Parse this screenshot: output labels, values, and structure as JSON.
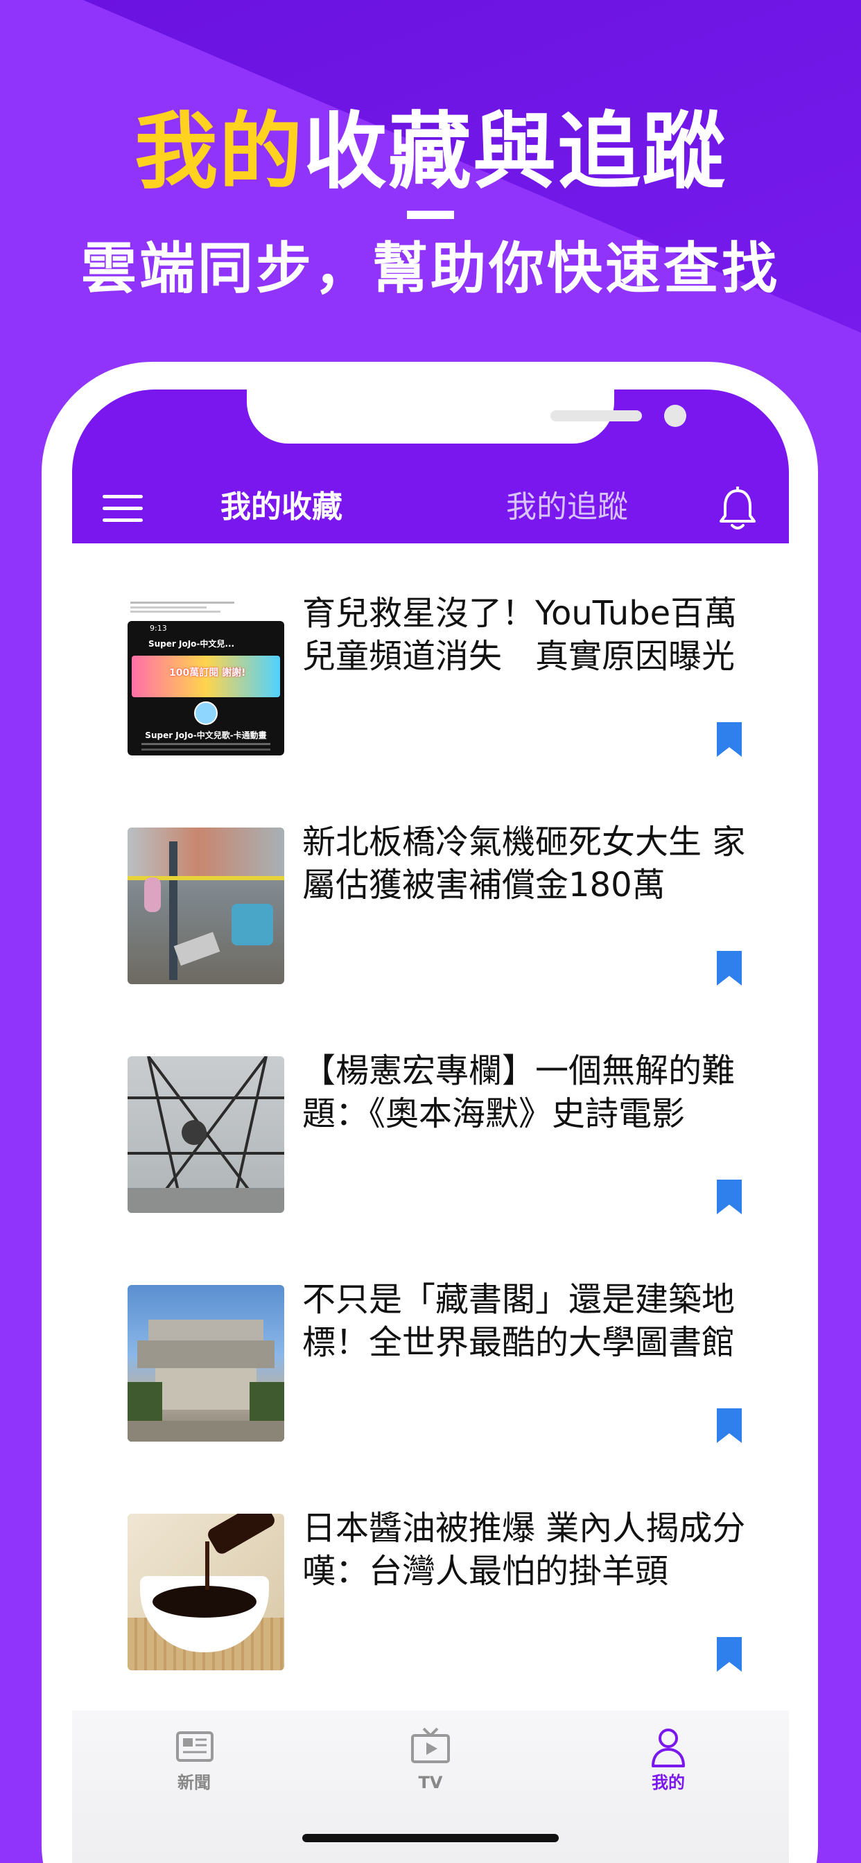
{
  "promo": {
    "headline_highlight": "我的",
    "headline_rest": "收藏與追蹤",
    "subline": "雲端同步，幫助你快速查找"
  },
  "header": {
    "tab_favorites": "我的收藏",
    "tab_following": "我的追蹤"
  },
  "articles": [
    {
      "title": "育兒救星沒了！YouTube百萬兒童頻道消失　真實原因曝光"
    },
    {
      "title": "新北板橋冷氣機砸死女大生 家屬估獲被害補償金180萬"
    },
    {
      "title": "【楊憲宏專欄】一個無解的難題：《奧本海默》史詩電影"
    },
    {
      "title": "不只是「藏書閣」還是建築地標！全世界最酷的大學圖書館"
    },
    {
      "title": "日本醬油被推爆 業內人揭成分嘆：台灣人最怕的掛羊頭"
    }
  ],
  "thumb1": {
    "channel": "Super JoJo-中文兒...",
    "banner": "100萬訂閱 謝謝!",
    "caption": "Super JoJo-中文兒歌-卡通動畫",
    "time": "9:13"
  },
  "tabbar": {
    "news": "新聞",
    "tv": "TV",
    "mine": "我的"
  },
  "colors": {
    "brand_purple": "#7a17ee",
    "highlight_yellow": "#ffd21f",
    "bookmark_blue": "#2f80ed"
  }
}
